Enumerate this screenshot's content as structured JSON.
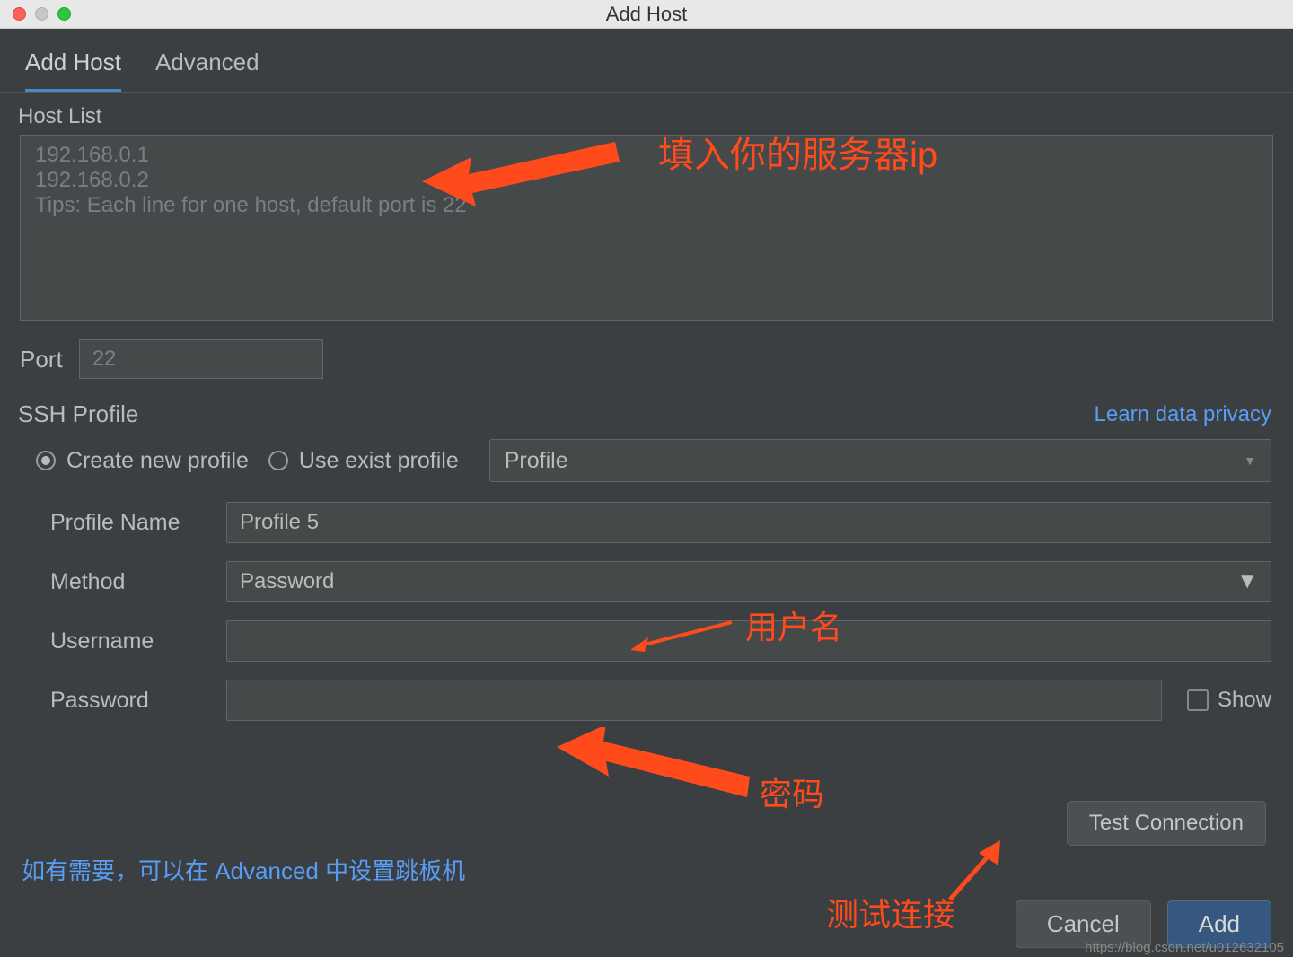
{
  "titlebar": {
    "title": "Add Host"
  },
  "tabs": {
    "add_host": "Add Host",
    "advanced": "Advanced"
  },
  "hostlist": {
    "label": "Host List",
    "placeholder": "192.168.0.1\n192.168.0.2\nTips: Each line for one host, default port is 22"
  },
  "port": {
    "label": "Port",
    "value": "22"
  },
  "ssh": {
    "label": "SSH Profile",
    "privacy_link": "Learn data privacy",
    "create_label": "Create new profile",
    "exist_label": "Use exist profile",
    "profile_select": "Profile"
  },
  "form": {
    "profile_name_label": "Profile Name",
    "profile_name_value": "Profile 5",
    "method_label": "Method",
    "method_value": "Password",
    "username_label": "Username",
    "username_value": "",
    "password_label": "Password",
    "password_value": "",
    "show_label": "Show"
  },
  "buttons": {
    "test": "Test Connection",
    "cancel": "Cancel",
    "add": "Add"
  },
  "footer_note": "如有需要，可以在 Advanced 中设置跳板机",
  "watermark": "https://blog.csdn.net/u012632105",
  "annotations": {
    "ip_hint": "填入你的服务器ip",
    "username_hint": "用户名",
    "password_hint": "密码",
    "test_hint": "测试连接"
  }
}
